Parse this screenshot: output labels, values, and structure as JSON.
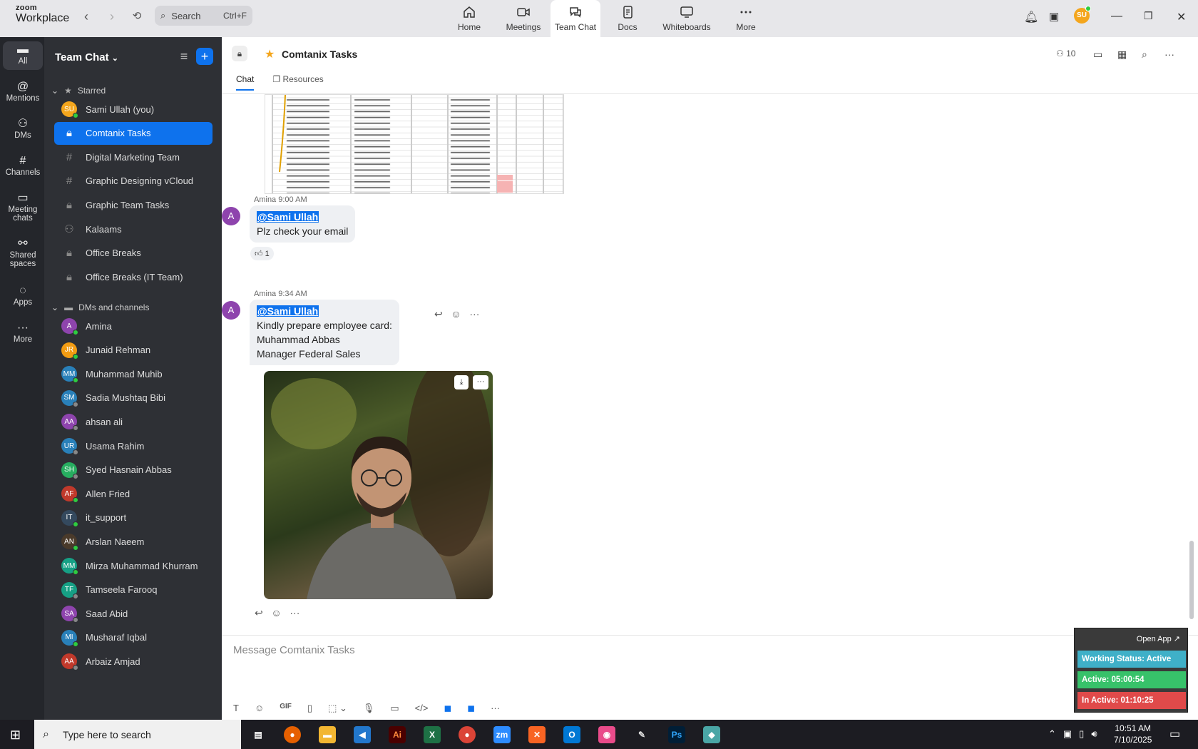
{
  "app": {
    "brand_top": "zoom",
    "brand_bottom": "Workplace"
  },
  "search": {
    "label": "Search",
    "shortcut": "Ctrl+F"
  },
  "tabs": [
    {
      "label": "Home"
    },
    {
      "label": "Meetings"
    },
    {
      "label": "Team Chat"
    },
    {
      "label": "Docs"
    },
    {
      "label": "Whiteboards"
    },
    {
      "label": "More"
    }
  ],
  "user_initials": "SU",
  "rail": [
    {
      "label": "All"
    },
    {
      "label": "Mentions"
    },
    {
      "label": "DMs"
    },
    {
      "label": "Channels"
    },
    {
      "label": "Meeting chats"
    },
    {
      "label": "Shared spaces"
    },
    {
      "label": "Apps"
    },
    {
      "label": "More"
    }
  ],
  "sidebar": {
    "title": "Team Chat",
    "starred_label": "Starred",
    "dms_label": "DMs and channels",
    "starred": [
      {
        "label": "Sami Ullah (you)",
        "initials": "SU",
        "color": "#f4a61d",
        "kind": "avatar",
        "status": "#2ecc40"
      },
      {
        "label": "Comtanix Tasks",
        "kind": "lock",
        "selected": true
      },
      {
        "label": "Digital Marketing Team",
        "kind": "hash"
      },
      {
        "label": "Graphic Designing vCloud",
        "kind": "hash"
      },
      {
        "label": "Graphic Team Tasks",
        "kind": "lock"
      },
      {
        "label": "Kalaams",
        "kind": "group"
      },
      {
        "label": "Office Breaks",
        "kind": "lock"
      },
      {
        "label": "Office Breaks (IT Team)",
        "kind": "lock"
      }
    ],
    "dms": [
      {
        "label": "Amina",
        "initials": "A",
        "color": "#8e44ad",
        "status": "#2ecc40"
      },
      {
        "label": "Junaid Rehman",
        "initials": "JR",
        "color": "#f39c12",
        "status": "#2ecc40"
      },
      {
        "label": "Muhammad Muhib",
        "initials": "MM",
        "color": "#2980b9",
        "status": "#2ecc40"
      },
      {
        "label": "Sadia Mushtaq Bibi",
        "initials": "SM",
        "color": "#2980b9",
        "status": "#888"
      },
      {
        "label": "ahsan ali",
        "initials": "AA",
        "color": "#8e44ad",
        "status": "#888"
      },
      {
        "label": "Usama Rahim",
        "initials": "UR",
        "color": "#2980b9",
        "status": "#888"
      },
      {
        "label": "Syed Hasnain Abbas",
        "initials": "SH",
        "color": "#27ae60",
        "status": "#888"
      },
      {
        "label": "Allen Fried",
        "initials": "AF",
        "color": "#c0392b",
        "status": "#2ecc40"
      },
      {
        "label": "it_support",
        "initials": "IT",
        "color": "#34495e",
        "status": "#2ecc40"
      },
      {
        "label": "Arslan Naeem",
        "initials": "AN",
        "color": "#4a3a2a",
        "status": "#2ecc40"
      },
      {
        "label": "Mirza Muhammad Khurram",
        "initials": "MM",
        "color": "#16a085",
        "status": "#2ecc40"
      },
      {
        "label": "Tamseela Farooq",
        "initials": "TF",
        "color": "#16a085",
        "status": "#888"
      },
      {
        "label": "Saad Abid",
        "initials": "SA",
        "color": "#8e44ad",
        "status": "#888"
      },
      {
        "label": "Musharaf Iqbal",
        "initials": "MI",
        "color": "#2980b9",
        "status": "#2ecc40"
      },
      {
        "label": "Arbaiz Amjad",
        "initials": "AA",
        "color": "#c0392b",
        "status": "#888"
      }
    ]
  },
  "channel": {
    "title": "Comtanix Tasks",
    "members": "10",
    "tab_chat": "Chat",
    "tab_resources": "Resources"
  },
  "messages": [
    {
      "author": "Amina",
      "time": "9:00 AM",
      "mention": "@Sami Ullah",
      "lines": [
        "Plz check your email"
      ],
      "reaction": "1"
    },
    {
      "author": "Amina",
      "time": "9:34 AM",
      "mention": "@Sami Ullah",
      "lines": [
        "Kindly prepare employee card:",
        "Muhammad Abbas",
        "Manager Federal Sales"
      ]
    }
  ],
  "composer": {
    "placeholder": "Message Comtanix Tasks"
  },
  "widget": {
    "open_app": "Open App ↗",
    "working": "Working Status: Active",
    "active": "Active: 05:00:54",
    "inactive": "In Active: 01:10:25"
  },
  "taskbar": {
    "search": "Type here to search",
    "time": "10:51 AM",
    "date": "7/10/2025"
  }
}
